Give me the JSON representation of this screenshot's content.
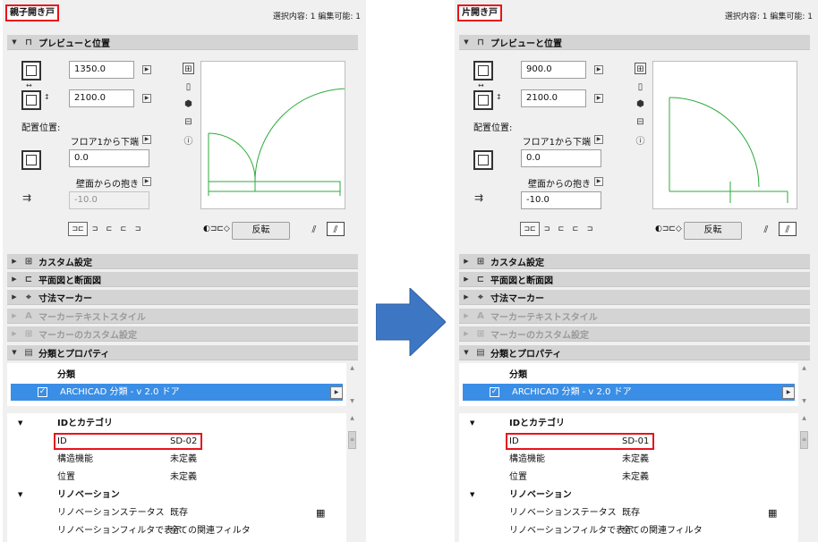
{
  "left": {
    "title": "親子開き戸",
    "selection_info": "選択内容: 1 編集可能: 1",
    "preview_section": "プレビューと位置",
    "width_value": "1350.0",
    "height_value": "2100.0",
    "anchor_label": "配置位置:",
    "floor_dropdown": "フロア1から下端",
    "floor_value": "0.0",
    "reveal_dropdown": "壁面からの抱き",
    "reveal_value": "-10.0",
    "flip_button": "反転",
    "sections": [
      "カスタム設定",
      "平面図と断面図",
      "寸法マーカー",
      "マーカーテキストスタイル",
      "マーカーのカスタム設定",
      "分類とプロパティ"
    ],
    "classification_header": "分類",
    "classification_value": "ARCHICAD 分類 - v 2.0  ドア",
    "id_group": "IDとカテゴリ",
    "id_label": "ID",
    "id_value": "SD-02",
    "struct_label": "構造機能",
    "struct_value": "未定義",
    "pos_label": "位置",
    "pos_value": "未定義",
    "reno_group": "リノベーション",
    "reno_status_label": "リノベーションステータス",
    "reno_status_value": "既存",
    "reno_filter_label": "リノベーションフィルタで表示",
    "reno_filter_value": "全ての関連フィルタ"
  },
  "right": {
    "title": "片開き戸",
    "selection_info": "選択内容: 1 編集可能: 1",
    "preview_section": "プレビューと位置",
    "width_value": "900.0",
    "height_value": "2100.0",
    "anchor_label": "配置位置:",
    "floor_dropdown": "フロア1から下端",
    "floor_value": "0.0",
    "reveal_dropdown": "壁面からの抱き",
    "reveal_value": "-10.0",
    "flip_button": "反転",
    "sections": [
      "カスタム設定",
      "平面図と断面図",
      "寸法マーカー",
      "マーカーテキストスタイル",
      "マーカーのカスタム設定",
      "分類とプロパティ"
    ],
    "classification_header": "分類",
    "classification_value": "ARCHICAD 分類 - v 2.0  ドア",
    "id_group": "IDとカテゴリ",
    "id_label": "ID",
    "id_value": "SD-01",
    "struct_label": "構造機能",
    "struct_value": "未定義",
    "pos_label": "位置",
    "pos_value": "未定義",
    "reno_group": "リノベーション",
    "reno_status_label": "リノベーションステータス",
    "reno_status_value": "既存",
    "reno_filter_label": "リノベーションフィルタで表示",
    "reno_filter_value": "全ての関連フィルタ"
  },
  "colors": {
    "accent": "#3a8ee6",
    "highlight_red": "#e8141b",
    "arrow": "#3d77c4",
    "plan_line": "#2bab3a"
  }
}
